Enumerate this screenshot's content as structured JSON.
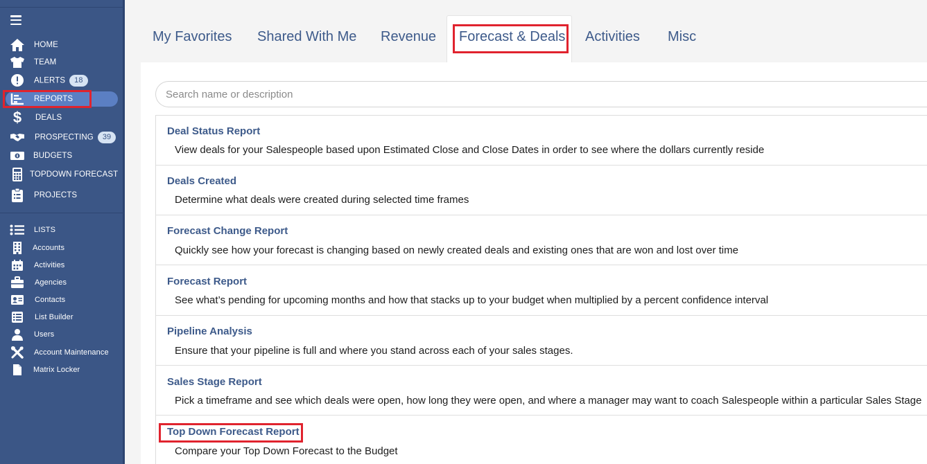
{
  "sidebar": {
    "items": [
      {
        "label": "HOME",
        "icon": "home-icon"
      },
      {
        "label": "TEAM",
        "icon": "shirt-icon"
      },
      {
        "label": "ALERTS",
        "icon": "alert-icon",
        "badge": "18"
      },
      {
        "label": "REPORTS",
        "icon": "chart-icon"
      },
      {
        "label": "DEALS",
        "icon": "dollar-icon"
      },
      {
        "label": "PROSPECTING",
        "icon": "handshake-icon",
        "badge": "39"
      },
      {
        "label": "BUDGETS",
        "icon": "money-icon"
      },
      {
        "label": "TOPDOWN FORECAST",
        "icon": "calculator-icon"
      },
      {
        "label": "PROJECTS",
        "icon": "clipboard-icon"
      }
    ],
    "lists": [
      {
        "label": "LISTS",
        "icon": "list-icon"
      },
      {
        "label": "Accounts",
        "icon": "building-icon"
      },
      {
        "label": "Activities",
        "icon": "calendar-icon"
      },
      {
        "label": "Agencies",
        "icon": "briefcase-icon"
      },
      {
        "label": "Contacts",
        "icon": "id-card-icon"
      },
      {
        "label": "List Builder",
        "icon": "list-builder-icon"
      },
      {
        "label": "Users",
        "icon": "user-icon"
      },
      {
        "label": "Account Maintenance",
        "icon": "tools-icon"
      },
      {
        "label": "Matrix Locker",
        "icon": "file-icon"
      }
    ]
  },
  "tabs": [
    "My Favorites",
    "Shared With Me",
    "Revenue",
    "Forecast & Deals",
    "Activities",
    "Misc"
  ],
  "search": {
    "placeholder": "Search name or description"
  },
  "reports": [
    {
      "title": "Deal Status Report",
      "desc": "View deals for your Salespeople based upon Estimated Close and Close Dates in order to see where the dollars currently reside"
    },
    {
      "title": "Deals Created",
      "desc": "Determine what deals were created during selected time frames"
    },
    {
      "title": "Forecast Change Report",
      "desc": "Quickly see how your forecast is changing based on newly created deals and existing ones that are won and lost over time"
    },
    {
      "title": "Forecast Report",
      "desc": "See what’s pending for upcoming months and how that stacks up to your budget when multiplied by a percent confidence interval"
    },
    {
      "title": "Pipeline Analysis",
      "desc": "Ensure that your pipeline is full and where you stand across each of your sales stages."
    },
    {
      "title": "Sales Stage Report",
      "desc": "Pick a timeframe and see which deals were open, how long they were open, and where a manager may want to coach Salespeople within a particular Sales Stage"
    },
    {
      "title": "Top Down Forecast Report",
      "desc": "Compare your Top Down Forecast to the Budget"
    }
  ],
  "colors": {
    "sidebar": "#3b5686",
    "active": "#5b7fc3",
    "accent": "#3d5a8a",
    "highlight": "#e0232e"
  }
}
